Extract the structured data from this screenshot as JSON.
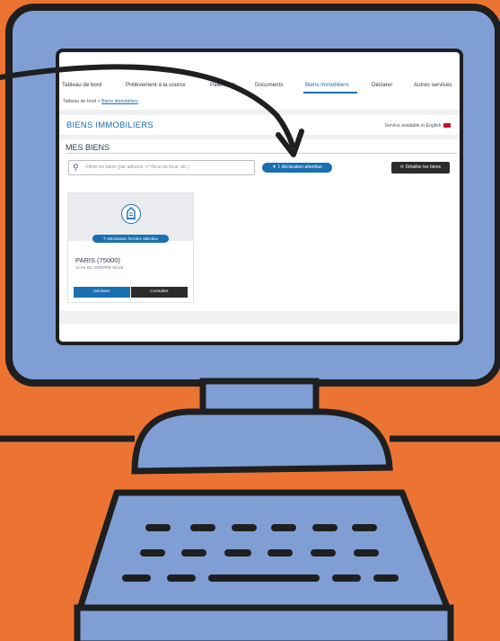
{
  "nav": {
    "items": [
      "Tableau de bord",
      "Prélèvement à la source",
      "Paiements",
      "Documents",
      "Biens immobiliers",
      "Déclarer",
      "Autres services"
    ],
    "active_index": 4
  },
  "breadcrumb": {
    "home": "Tableau de bord",
    "separator": ">",
    "current": "Biens immobiliers"
  },
  "page": {
    "title": "BIENS IMMOBILIERS",
    "service_note": "Service available in English"
  },
  "section": {
    "title": "MES BIENS"
  },
  "toolbar": {
    "search_placeholder": "Filtrer les biens (par adresse, n° fiscal du local, etc.)",
    "filter_button": "1 déclaration attendue",
    "detail_button": "Détailler les biens"
  },
  "card": {
    "badge": "Déclaration foncière attendue",
    "city": "PARIS   (75000)",
    "address": "11 AV DU CENTRE VILLE",
    "declare_button": "Déclarer",
    "consult_button": "Consulter"
  },
  "colors": {
    "background": "#ec7433",
    "monitor": "#7f9fd4",
    "accent": "#1a6fb0",
    "dark": "#2b2b2b"
  }
}
